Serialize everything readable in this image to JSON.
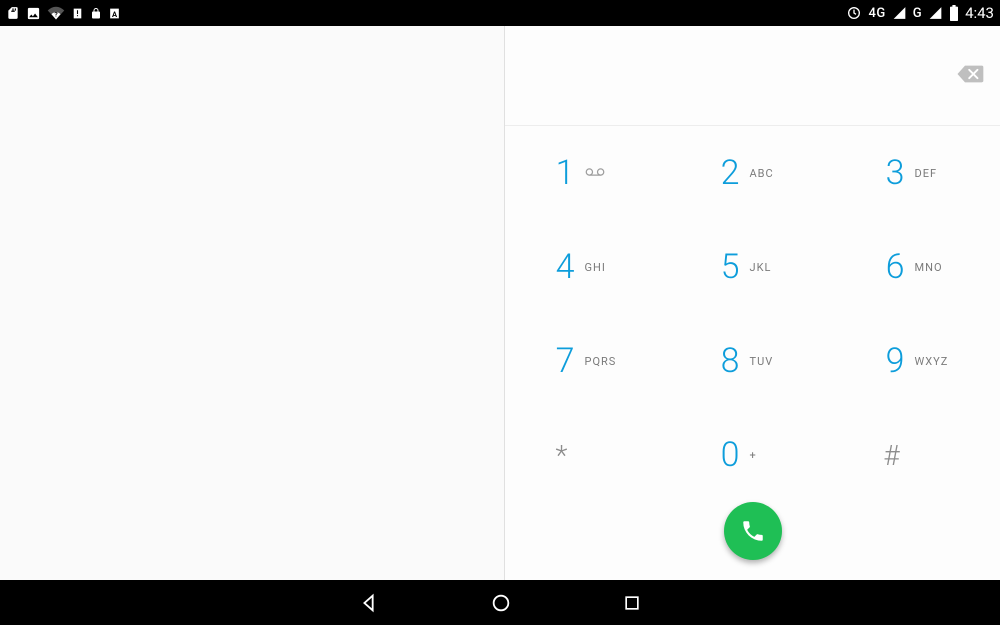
{
  "statusbar": {
    "net1": "4G",
    "net2": "G",
    "clock": "4:43"
  },
  "dialer": {
    "entered_number": "",
    "keys": [
      {
        "digit": "1",
        "letters": "",
        "voicemail": true
      },
      {
        "digit": "2",
        "letters": "ABC"
      },
      {
        "digit": "3",
        "letters": "DEF"
      },
      {
        "digit": "4",
        "letters": "GHI"
      },
      {
        "digit": "5",
        "letters": "JKL"
      },
      {
        "digit": "6",
        "letters": "MNO"
      },
      {
        "digit": "7",
        "letters": "PQRS"
      },
      {
        "digit": "8",
        "letters": "TUV"
      },
      {
        "digit": "9",
        "letters": "WXYZ"
      },
      {
        "digit": "*",
        "letters": "",
        "symbol": true
      },
      {
        "digit": "0",
        "letters": "+"
      },
      {
        "digit": "#",
        "letters": "",
        "symbol": true
      }
    ]
  }
}
